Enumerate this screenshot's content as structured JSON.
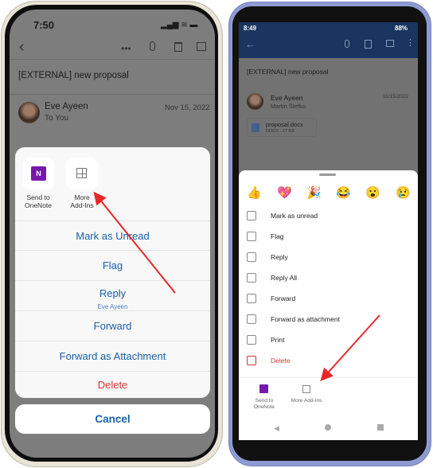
{
  "iphone": {
    "status_time": "7:50",
    "subject": "[EXTERNAL] new proposal",
    "sender": "Eve Ayeen",
    "recipient": "To You",
    "date": "Nov 15, 2022",
    "addins": [
      {
        "label_1": "Send to",
        "label_2": "OneNote",
        "icon": "onenote-icon"
      },
      {
        "label_1": "More",
        "label_2": "Add-Ins",
        "icon": "add-ins-icon"
      }
    ],
    "actions": [
      {
        "label": "Mark as Unread"
      },
      {
        "label": "Flag"
      },
      {
        "label": "Reply",
        "sub": "Eve Ayeen"
      },
      {
        "label": "Forward"
      },
      {
        "label": "Forward as Attachment"
      },
      {
        "label": "Delete"
      }
    ],
    "cancel": "Cancel",
    "colors": {
      "action": "#1a5fa8",
      "destructive": "#e0322f"
    }
  },
  "android": {
    "status_time": "8:49",
    "battery": "88%",
    "subject": "[EXTERNAL] new proposal",
    "sender": "Eve Ayeen",
    "recipient": "Martin Štefko",
    "date": "11/15/2022",
    "attachment": {
      "name": "proposal.docx",
      "meta": "DOCX - 17 KB"
    },
    "reactions": [
      "👍",
      "💖",
      "🎉",
      "😂",
      "😮",
      "😢"
    ],
    "menu": [
      {
        "label": "Mark as unread",
        "icon": "mail-unread-icon"
      },
      {
        "label": "Flag",
        "icon": "flag-icon"
      },
      {
        "label": "Reply",
        "icon": "reply-icon"
      },
      {
        "label": "Reply All",
        "icon": "reply-all-icon"
      },
      {
        "label": "Forward",
        "icon": "forward-icon"
      },
      {
        "label": "Forward as attachment",
        "icon": "forward-attachment-icon"
      },
      {
        "label": "Print",
        "icon": "print-icon"
      },
      {
        "label": "Delete",
        "icon": "trash-icon"
      }
    ],
    "addins": [
      {
        "label_1": "Send to",
        "label_2": "OneNote"
      },
      {
        "label_1": "More Add-Ins"
      }
    ],
    "colors": {
      "appbar": "#1a3560",
      "destructive": "#d13438"
    }
  },
  "annotation_color": "#e8262a"
}
